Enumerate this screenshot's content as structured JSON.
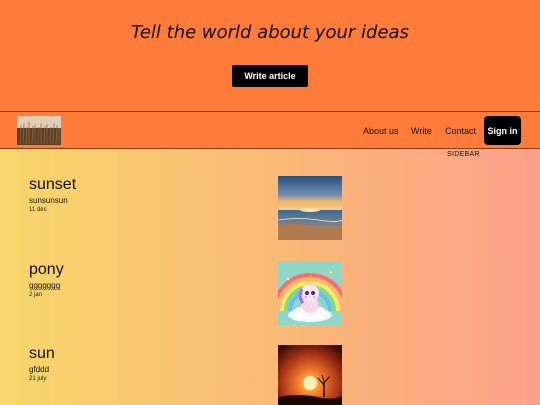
{
  "hero": {
    "title": "Tell the world about your ideas",
    "write_button": "Write article"
  },
  "nav": {
    "links": [
      "About us",
      "Write",
      "Contact"
    ],
    "signin": "Sign in"
  },
  "sidebar": {
    "label": "SIDEBAR"
  },
  "posts": [
    {
      "title": "sunset",
      "subtitle": "sunsunsun",
      "date": "11 dec",
      "image_icon": "sunset-beach-image"
    },
    {
      "title": "pony",
      "subtitle": "ggggggg",
      "date": "2 jan",
      "image_icon": "unicorn-image"
    },
    {
      "title": "sun",
      "subtitle": "gfddd",
      "date": "21 july",
      "image_icon": "sunset-tree-image"
    }
  ],
  "colors": {
    "header_bg": "#ff7b3a",
    "content_gradient_start": "#f7d76a",
    "content_gradient_end": "#fca08a",
    "button_bg": "#000000"
  }
}
